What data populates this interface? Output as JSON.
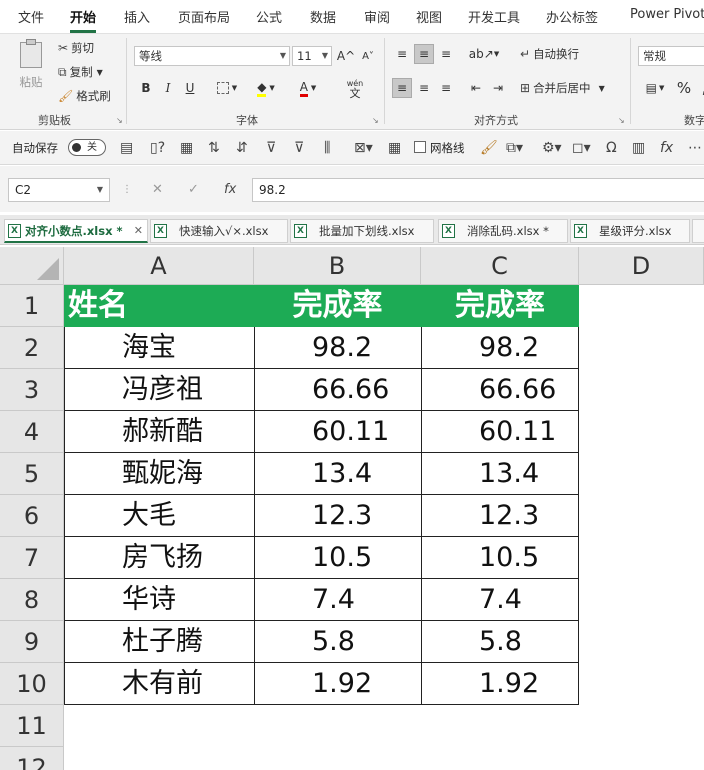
{
  "menu": {
    "tabs": [
      "文件",
      "开始",
      "插入",
      "页面布局",
      "公式",
      "数据",
      "审阅",
      "视图",
      "开发工具",
      "办公标签",
      "Power Pivot"
    ],
    "active_index": 1
  },
  "ribbon": {
    "clipboard": {
      "paste": "粘贴",
      "cut": "剪切",
      "copy": "复制",
      "format_painter": "格式刷",
      "label": "剪贴板"
    },
    "font": {
      "name": "等线",
      "size": "11",
      "label": "字体",
      "bold": "B",
      "italic": "I",
      "underline": "U",
      "grow": "A^",
      "shrink": "A˅",
      "font_color_letter": "A",
      "pinyin_top": "wén",
      "pinyin_bottom": "文"
    },
    "alignment": {
      "wrap": "自动换行",
      "merge": "合并后居中",
      "label": "对齐方式"
    },
    "number": {
      "format": "常规",
      "label": "数字",
      "percent": "%"
    }
  },
  "quickbar": {
    "autosave_label": "自动保存",
    "autosave_state": "关",
    "gridlines_label": "网格线"
  },
  "formula_bar": {
    "name_box": "C2",
    "fx": "fx",
    "value": "98.2"
  },
  "sheet_tabs": [
    {
      "label": "对齐小数点.xlsx *",
      "active": true
    },
    {
      "label": "快速输入√×.xlsx",
      "active": false
    },
    {
      "label": "批量加下划线.xlsx",
      "active": false
    },
    {
      "label": "消除乱码.xlsx *",
      "active": false
    },
    {
      "label": "星级评分.xlsx",
      "active": false
    }
  ],
  "sheet": {
    "columns": [
      "A",
      "B",
      "C",
      "D"
    ],
    "rows": [
      "1",
      "2",
      "3",
      "4",
      "5",
      "6",
      "7",
      "8",
      "9",
      "10",
      "11",
      "12"
    ],
    "header": [
      "姓名",
      "完成率",
      "完成率"
    ],
    "data": [
      [
        "海宝",
        "98.2",
        "98.2"
      ],
      [
        "冯彦祖",
        "66.66",
        "66.66"
      ],
      [
        "郝新酷",
        "60.11",
        "60.11"
      ],
      [
        "甄妮海",
        "13.4",
        "13.4"
      ],
      [
        "大毛",
        "12.3",
        "12.3"
      ],
      [
        "房飞扬",
        "10.5",
        "10.5"
      ],
      [
        "华诗",
        "7.4",
        "7.4"
      ],
      [
        "杜子腾",
        "5.8",
        "5.8"
      ],
      [
        "木有前",
        "1.92",
        "1.92"
      ]
    ],
    "header_color": "#1dab55"
  }
}
